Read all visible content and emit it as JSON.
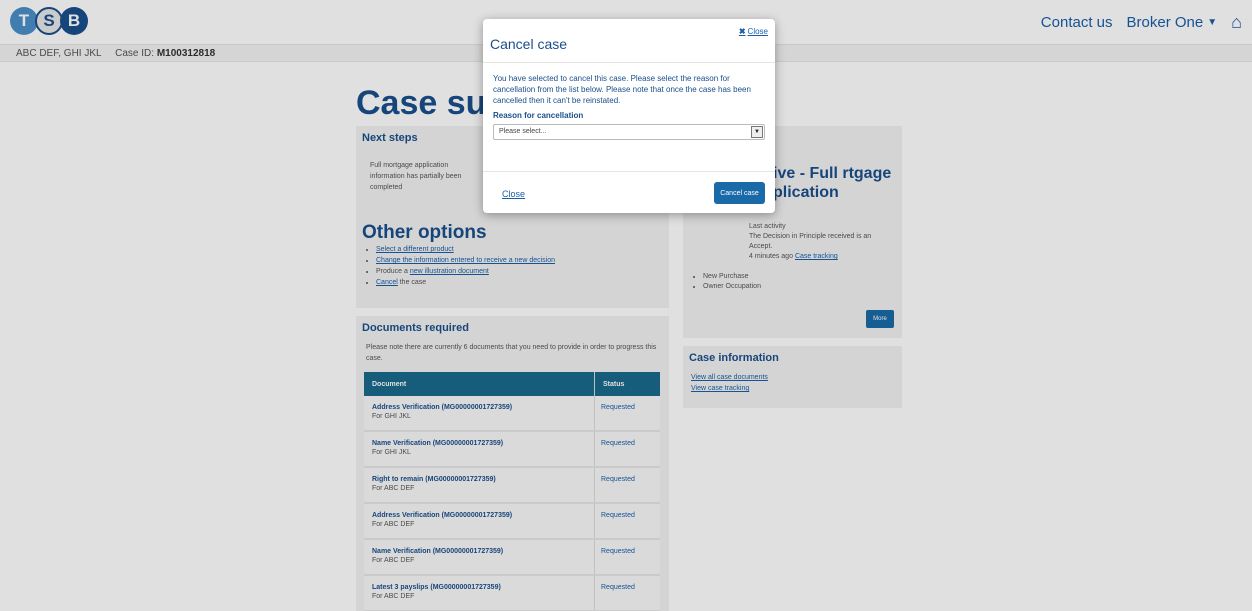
{
  "header": {
    "logo_letters": [
      "T",
      "S",
      "B"
    ],
    "contact_label": "Contact us",
    "broker_label": "Broker One",
    "caret_icon": "caret-down-icon",
    "home_icon": "home-icon"
  },
  "subbar": {
    "applicants": "ABC DEF, GHI JKL",
    "case_id_label": "Case ID:",
    "case_id": "M100312818"
  },
  "main": {
    "title": "Case sum",
    "next_steps": {
      "title": "Next steps",
      "text": "Full mortgage application information has partially been completed"
    },
    "other_options": {
      "title": "Other options",
      "items": [
        {
          "link": "Select a different product",
          "rest": ""
        },
        {
          "link": "Change the information entered to receive a new decision",
          "rest": ""
        },
        {
          "prefix": "Produce a ",
          "link": "new illustration document",
          "rest": ""
        },
        {
          "link": "Cancel",
          "rest": " the case"
        }
      ]
    },
    "documents": {
      "title": "Documents required",
      "note": "Please note there are currently 6 documents that you need to provide in order to progress this case.",
      "headers": {
        "document": "Document",
        "status": "Status"
      },
      "rows": [
        {
          "name": "Address Verification (MG00000001727359)",
          "for": "For GHI JKL",
          "status": "Requested"
        },
        {
          "name": "Name Verification (MG00000001727359)",
          "for": "For GHI JKL",
          "status": "Requested"
        },
        {
          "name": "Right to remain (MG00000001727359)",
          "for": "For ABC DEF",
          "status": "Requested"
        },
        {
          "name": "Address Verification (MG00000001727359)",
          "for": "For ABC DEF",
          "status": "Requested"
        },
        {
          "name": "Name Verification (MG00000001727359)",
          "for": "For ABC DEF",
          "status": "Requested"
        },
        {
          "name": "Latest 3 payslips (MG00000001727359)",
          "for": "For ABC DEF",
          "status": "Requested"
        }
      ]
    },
    "decision": {
      "title": "ive - Full rtgage plication",
      "activity_label": "Last activity",
      "activity_text": "The Decision in Principle received is an Accept.",
      "activity_time": "4 minutes ago",
      "activity_link": "Case tracking",
      "list": [
        "New Purchase",
        "Owner Occupation"
      ],
      "more_label": "More"
    },
    "case_info": {
      "title": "Case information",
      "links": [
        "View all case documents",
        "View case tracking"
      ]
    }
  },
  "modal": {
    "title": "Cancel case",
    "close_top_label": "Close",
    "close_icon": "x-icon",
    "body_text": "You have selected to cancel this case. Please select the reason for cancellation from the list below. Please note that once the case has been cancelled then it can't be reinstated.",
    "reason_label": "Reason for cancellation",
    "select_value": "Please select...",
    "footer_close_label": "Close",
    "cancel_button_label": "Cancel case"
  }
}
